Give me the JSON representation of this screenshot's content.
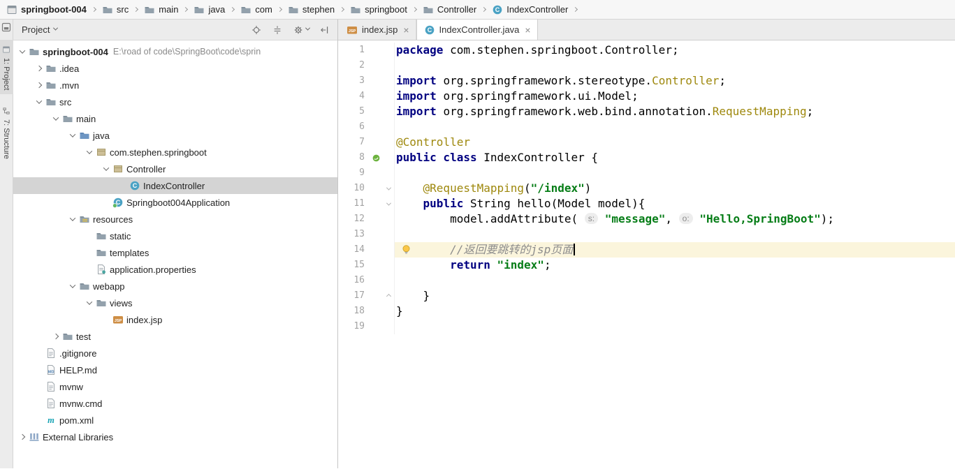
{
  "nav": {
    "breadcrumbs": [
      {
        "label": "springboot-004",
        "icon": "project",
        "bold": true
      },
      {
        "label": "src",
        "icon": "folder"
      },
      {
        "label": "main",
        "icon": "folder"
      },
      {
        "label": "java",
        "icon": "folder"
      },
      {
        "label": "com",
        "icon": "folder"
      },
      {
        "label": "stephen",
        "icon": "folder"
      },
      {
        "label": "springboot",
        "icon": "folder"
      },
      {
        "label": "Controller",
        "icon": "folder"
      },
      {
        "label": "IndexController",
        "icon": "class"
      }
    ]
  },
  "tool_strip": {
    "project_label": "1: Project",
    "structure_label": "7: Structure"
  },
  "project_panel": {
    "title": "Project",
    "actions": [
      "locate",
      "collapse",
      "gear",
      "hide"
    ],
    "tree": [
      {
        "depth": 0,
        "label": "springboot-004",
        "bold": true,
        "extra": "E:\\road of code\\SpringBoot\\code\\sprin",
        "icon": "folder",
        "state": "expanded"
      },
      {
        "depth": 1,
        "label": ".idea",
        "icon": "folder",
        "state": "collapsed"
      },
      {
        "depth": 1,
        "label": ".mvn",
        "icon": "folder",
        "state": "collapsed"
      },
      {
        "depth": 1,
        "label": "src",
        "icon": "folder",
        "state": "expanded"
      },
      {
        "depth": 2,
        "label": "main",
        "icon": "folder",
        "state": "expanded"
      },
      {
        "depth": 3,
        "label": "java",
        "icon": "folder-src",
        "state": "expanded"
      },
      {
        "depth": 4,
        "label": "com.stephen.springboot",
        "icon": "package",
        "state": "expanded"
      },
      {
        "depth": 5,
        "label": "Controller",
        "icon": "package",
        "state": "expanded"
      },
      {
        "depth": 6,
        "label": "IndexController",
        "icon": "class",
        "state": "leaf",
        "selected": true
      },
      {
        "depth": 5,
        "label": "Springboot004Application",
        "icon": "class-run",
        "state": "leaf"
      },
      {
        "depth": 3,
        "label": "resources",
        "icon": "folder-res",
        "state": "expanded"
      },
      {
        "depth": 4,
        "label": "static",
        "icon": "folder",
        "state": "leaf"
      },
      {
        "depth": 4,
        "label": "templates",
        "icon": "folder",
        "state": "leaf"
      },
      {
        "depth": 4,
        "label": "application.properties",
        "icon": "properties",
        "state": "leaf"
      },
      {
        "depth": 3,
        "label": "webapp",
        "icon": "folder",
        "state": "expanded"
      },
      {
        "depth": 4,
        "label": "views",
        "icon": "folder",
        "state": "expanded"
      },
      {
        "depth": 5,
        "label": "index.jsp",
        "icon": "jsp",
        "state": "leaf"
      },
      {
        "depth": 2,
        "label": "test",
        "icon": "folder",
        "state": "collapsed"
      },
      {
        "depth": 1,
        "label": ".gitignore",
        "icon": "file",
        "state": "leaf"
      },
      {
        "depth": 1,
        "label": "HELP.md",
        "icon": "md",
        "state": "leaf"
      },
      {
        "depth": 1,
        "label": "mvnw",
        "icon": "file",
        "state": "leaf"
      },
      {
        "depth": 1,
        "label": "mvnw.cmd",
        "icon": "file",
        "state": "leaf"
      },
      {
        "depth": 1,
        "label": "pom.xml",
        "icon": "maven",
        "state": "leaf"
      },
      {
        "depth": 0,
        "label": "External Libraries",
        "icon": "lib",
        "state": "collapsed"
      }
    ]
  },
  "tabs": [
    {
      "label": "index.jsp",
      "icon": "jsp",
      "active": false
    },
    {
      "label": "IndexController.java",
      "icon": "class",
      "active": true
    }
  ],
  "editor": {
    "lines": [
      {
        "n": 1,
        "tok": [
          [
            "k",
            "package "
          ],
          [
            "p",
            "com.stephen.springboot.Controller;"
          ]
        ]
      },
      {
        "n": 2,
        "tok": []
      },
      {
        "n": 3,
        "tok": [
          [
            "k",
            "import "
          ],
          [
            "p",
            "org.springframework.stereotype."
          ],
          [
            "a",
            "Controller"
          ],
          [
            "p",
            ";"
          ]
        ]
      },
      {
        "n": 4,
        "tok": [
          [
            "k",
            "import "
          ],
          [
            "p",
            "org.springframework.ui.Model;"
          ]
        ]
      },
      {
        "n": 5,
        "tok": [
          [
            "k",
            "import "
          ],
          [
            "p",
            "org.springframework.web.bind.annotation."
          ],
          [
            "a",
            "RequestMapping"
          ],
          [
            "p",
            ";"
          ]
        ]
      },
      {
        "n": 6,
        "tok": []
      },
      {
        "n": 7,
        "tok": [
          [
            "a",
            "@Controller"
          ]
        ]
      },
      {
        "n": 8,
        "tok": [
          [
            "k",
            "public class "
          ],
          [
            "p",
            "IndexController {"
          ]
        ],
        "gutter": "spring"
      },
      {
        "n": 9,
        "tok": []
      },
      {
        "n": 10,
        "tok": [
          [
            "p",
            "    "
          ],
          [
            "a",
            "@RequestMapping"
          ],
          [
            "p",
            "("
          ],
          [
            "s",
            "\"/index\""
          ],
          [
            "p",
            ")"
          ]
        ],
        "fold": "down"
      },
      {
        "n": 11,
        "tok": [
          [
            "p",
            "    "
          ],
          [
            "k",
            "public "
          ],
          [
            "p",
            "String hello(Model model){"
          ]
        ],
        "fold": "down"
      },
      {
        "n": 12,
        "tok": [
          [
            "p",
            "        model.addAttribute( "
          ],
          [
            "h",
            "s:"
          ],
          [
            "p",
            " "
          ],
          [
            "s",
            "\"message\""
          ],
          [
            "p",
            ", "
          ],
          [
            "h",
            "o:"
          ],
          [
            "p",
            " "
          ],
          [
            "s",
            "\"Hello,SpringBoot\""
          ],
          [
            "p",
            ");"
          ]
        ]
      },
      {
        "n": 13,
        "tok": []
      },
      {
        "n": 14,
        "tok": [
          [
            "p",
            "        "
          ],
          [
            "c",
            "//返回要跳转的jsp页面"
          ]
        ],
        "hl": true,
        "bulb": true,
        "caret": true
      },
      {
        "n": 15,
        "tok": [
          [
            "p",
            "        "
          ],
          [
            "k",
            "return "
          ],
          [
            "s",
            "\"index\""
          ],
          [
            "p",
            ";"
          ]
        ]
      },
      {
        "n": 16,
        "tok": []
      },
      {
        "n": 17,
        "tok": [
          [
            "p",
            "    }"
          ]
        ],
        "fold": "up"
      },
      {
        "n": 18,
        "tok": [
          [
            "p",
            "}"
          ]
        ]
      },
      {
        "n": 19,
        "tok": []
      }
    ]
  },
  "colors": {
    "keyword": "#000080",
    "string": "#067D17",
    "annotation": "#9E880D",
    "comment": "#8C8C8C",
    "selection_unfocused": "#D4D4D4",
    "caret_line_highlight": "#FBF5DC",
    "spring_green": "#6DB33F"
  }
}
